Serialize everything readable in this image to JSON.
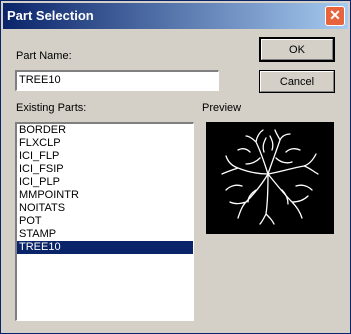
{
  "window": {
    "title": "Part Selection",
    "close_glyph": "✕"
  },
  "part_name": {
    "label": "Part Name:",
    "value": "TREE10"
  },
  "buttons": {
    "ok": "OK",
    "cancel": "Cancel"
  },
  "existing_parts": {
    "label": "Existing Parts:",
    "items": [
      "BORDER",
      "FLXCLP",
      "ICI_FLP",
      "ICI_FSIP",
      "ICI_PLP",
      "MMPOINTR",
      "NOITATS",
      "POT",
      "STAMP",
      "TREE10"
    ],
    "selected": "TREE10"
  },
  "preview": {
    "label": "Preview"
  },
  "colors": {
    "selection": "#0a246a",
    "title_start": "#0a246a",
    "title_end": "#a6caf0",
    "close": "#e8643c"
  }
}
